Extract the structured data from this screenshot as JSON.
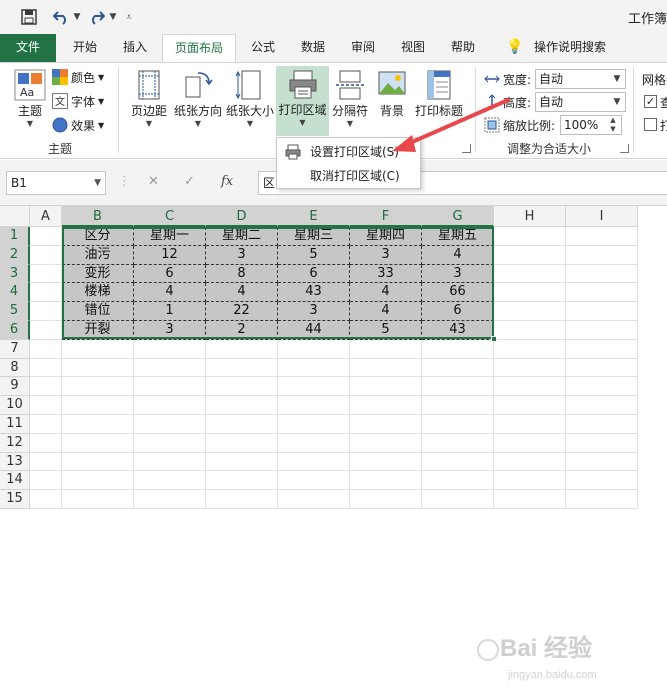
{
  "window": {
    "title": "工作簿"
  },
  "tabs": [
    {
      "label": "文件"
    },
    {
      "label": "开始"
    },
    {
      "label": "插入"
    },
    {
      "label": "页面布局"
    },
    {
      "label": "公式"
    },
    {
      "label": "数据"
    },
    {
      "label": "审阅"
    },
    {
      "label": "视图"
    },
    {
      "label": "帮助"
    },
    {
      "label": "操作说明搜索"
    }
  ],
  "ribbon": {
    "theme_group": {
      "theme_label": "主题",
      "colors_label": "颜色",
      "fonts_label": "字体",
      "effects_label": "效果",
      "group_label": "主题"
    },
    "page_setup": {
      "margins": "页边距",
      "orientation": "纸张方向",
      "size": "纸张大小",
      "print_area": "打印区域",
      "breaks": "分隔符",
      "background": "背景",
      "print_titles": "打印标题",
      "group_label": "页面设置"
    },
    "scale": {
      "width_label": "宽度:",
      "width_value": "自动",
      "height_label": "高度:",
      "height_value": "自动",
      "scale_label": "缩放比例:",
      "scale_value": "100%",
      "group_label": "调整为合适大小"
    },
    "sheet_options": {
      "group_label": "网格线",
      "view_label": "查看",
      "print_label": "打印"
    }
  },
  "print_area_menu": {
    "set": "设置打印区域(S)",
    "clear": "取消打印区域(C)"
  },
  "formula_bar": {
    "name_box": "B1",
    "cancel": "✕",
    "enter": "✓",
    "fx": "fx",
    "content": "区"
  },
  "sheet": {
    "columns": [
      "A",
      "B",
      "C",
      "D",
      "E",
      "F",
      "G",
      "H",
      "I"
    ],
    "rows": [
      "1",
      "2",
      "3",
      "4",
      "5",
      "6",
      "7",
      "8",
      "9",
      "10",
      "11",
      "12",
      "13",
      "14",
      "15"
    ],
    "header": [
      "区分",
      "星期一",
      "星期二",
      "星期三",
      "星期四",
      "星期五"
    ],
    "data": [
      [
        "油污",
        "12",
        "3",
        "5",
        "3",
        "4"
      ],
      [
        "变形",
        "6",
        "8",
        "6",
        "33",
        "3"
      ],
      [
        "楼梯",
        "4",
        "4",
        "43",
        "4",
        "66"
      ],
      [
        "错位",
        "1",
        "22",
        "3",
        "4",
        "6"
      ],
      [
        "开裂",
        "3",
        "2",
        "44",
        "5",
        "43"
      ]
    ]
  },
  "watermark": {
    "text": "Bai 经验",
    "sub": "jingyan.baidu.com"
  },
  "colors": {
    "accent": "#217346",
    "arrow": "#e8484b"
  }
}
